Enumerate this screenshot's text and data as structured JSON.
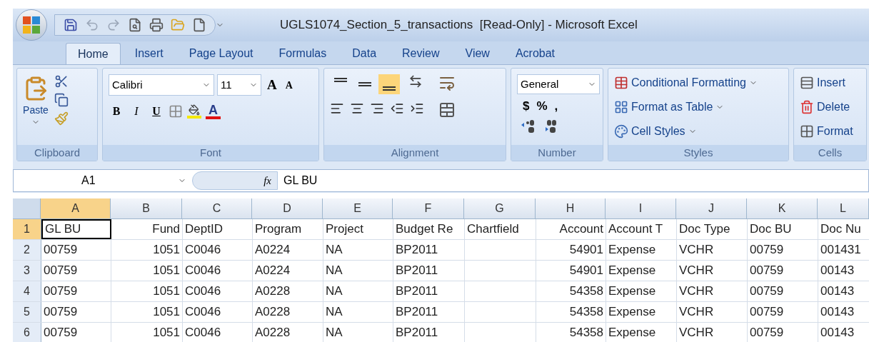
{
  "window": {
    "title": "UGLS1074_Section_5_transactions  [Read-Only] - Microsoft Excel"
  },
  "tabs": [
    {
      "label": "Home",
      "selected": true
    },
    {
      "label": "Insert",
      "selected": false
    },
    {
      "label": "Page Layout",
      "selected": false
    },
    {
      "label": "Formulas",
      "selected": false
    },
    {
      "label": "Data",
      "selected": false
    },
    {
      "label": "Review",
      "selected": false
    },
    {
      "label": "View",
      "selected": false
    },
    {
      "label": "Acrobat",
      "selected": false
    }
  ],
  "ribbon": {
    "clipboard": {
      "paste": "Paste",
      "label": "Clipboard"
    },
    "font": {
      "name": "Calibri",
      "size": "11",
      "grow": "A",
      "shrink": "A",
      "bold": "B",
      "italic": "I",
      "underline": "U",
      "font_color": "A",
      "label": "Font"
    },
    "alignment": {
      "vertical": [
        {
          "kind": "top",
          "selected": false
        },
        {
          "kind": "middle",
          "selected": false
        },
        {
          "kind": "bottom",
          "selected": true
        }
      ],
      "label": "Alignment"
    },
    "number": {
      "format": "General",
      "currency": "$",
      "percent": "%",
      "comma": ",",
      "label": "Number"
    },
    "styles": {
      "items": [
        "Conditional Formatting",
        "Format as Table",
        "Cell Styles"
      ],
      "label": "Styles"
    },
    "cells": {
      "items": [
        "Insert",
        "Delete",
        "Format"
      ],
      "label": "Cells"
    }
  },
  "formula_bar": {
    "name_box": "A1",
    "fx": "fx",
    "value": "GL BU"
  },
  "sheet": {
    "columns": [
      {
        "letter": "A",
        "right_aligned": false,
        "selected": true
      },
      {
        "letter": "B",
        "right_aligned": true,
        "selected": false
      },
      {
        "letter": "C",
        "right_aligned": false,
        "selected": false
      },
      {
        "letter": "D",
        "right_aligned": false,
        "selected": false
      },
      {
        "letter": "E",
        "right_aligned": false,
        "selected": false
      },
      {
        "letter": "F",
        "right_aligned": false,
        "selected": false
      },
      {
        "letter": "G",
        "right_aligned": false,
        "selected": false
      },
      {
        "letter": "H",
        "right_aligned": true,
        "selected": false
      },
      {
        "letter": "I",
        "right_aligned": false,
        "selected": false
      },
      {
        "letter": "J",
        "right_aligned": false,
        "selected": false
      },
      {
        "letter": "K",
        "right_aligned": false,
        "selected": false
      },
      {
        "letter": "L",
        "right_aligned": false,
        "selected": false
      }
    ],
    "rows": [
      {
        "number": "1",
        "selected": true,
        "cells": [
          "GL BU",
          "Fund",
          "DeptID",
          "Program",
          "Project",
          "Budget Re",
          "Chartfield",
          "Account",
          "Account T",
          "Doc Type",
          "Doc BU",
          "Doc Nu"
        ]
      },
      {
        "number": "2",
        "selected": false,
        "cells": [
          "00759",
          "1051",
          "C0046",
          "A0224",
          "NA",
          "BP2011",
          "",
          "54901",
          "Expense",
          "VCHR",
          "00759",
          "001431"
        ]
      },
      {
        "number": "3",
        "selected": false,
        "cells": [
          "00759",
          "1051",
          "C0046",
          "A0224",
          "NA",
          "BP2011",
          "",
          "54901",
          "Expense",
          "VCHR",
          "00759",
          "00143"
        ]
      },
      {
        "number": "4",
        "selected": false,
        "cells": [
          "00759",
          "1051",
          "C0046",
          "A0228",
          "NA",
          "BP2011",
          "",
          "54358",
          "Expense",
          "VCHR",
          "00759",
          "00143"
        ]
      },
      {
        "number": "5",
        "selected": false,
        "cells": [
          "00759",
          "1051",
          "C0046",
          "A0228",
          "NA",
          "BP2011",
          "",
          "54358",
          "Expense",
          "VCHR",
          "00759",
          "00143"
        ]
      },
      {
        "number": "6",
        "selected": false,
        "cells": [
          "00759",
          "1051",
          "C0046",
          "A0228",
          "NA",
          "BP2011",
          "",
          "54358",
          "Expense",
          "VCHR",
          "00759",
          "00143"
        ]
      }
    ]
  }
}
